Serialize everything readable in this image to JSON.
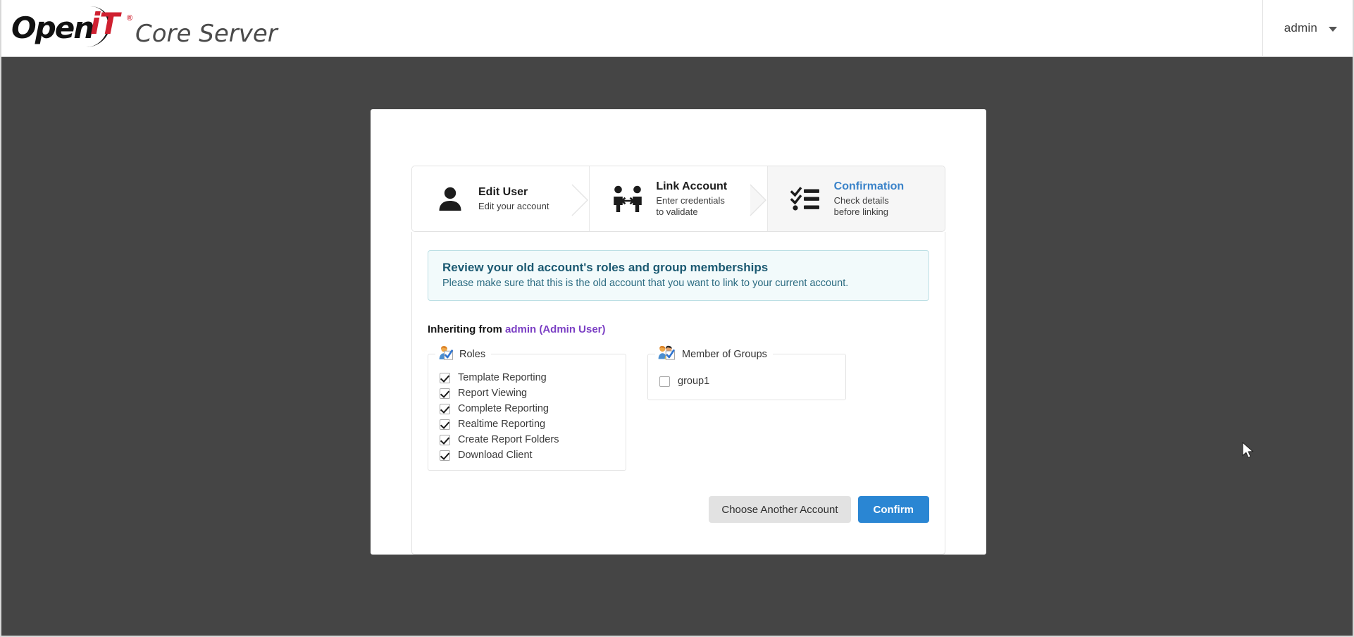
{
  "header": {
    "brand": {
      "logo_open": "Open",
      "logo_it": "iT",
      "logo_reg": "®",
      "product": "Core Server"
    },
    "user_menu": {
      "label": "admin",
      "caret_icon": "chevron-down-icon"
    }
  },
  "wizard": {
    "steps": [
      {
        "id": "edit-user",
        "icon": "user-icon",
        "title": "Edit User",
        "subtitle": "Edit your account",
        "active": false
      },
      {
        "id": "link-account",
        "icon": "link-accounts-icon",
        "title": "Link Account",
        "subtitle": "Enter credentials to validate",
        "subtitle_line1": "Enter credentials",
        "subtitle_line2": "to validate",
        "active": false
      },
      {
        "id": "confirmation",
        "icon": "checklist-icon",
        "title": "Confirmation",
        "subtitle": "Check details before linking",
        "subtitle_line1": "Check details",
        "subtitle_line2": "before linking",
        "active": true
      }
    ]
  },
  "alert": {
    "title": "Review your old account's roles and group memberships",
    "text": "Please make sure that this is the old account that you want to link to your current account."
  },
  "inheriting": {
    "prefix": "Inheriting from ",
    "account_link": "admin (Admin User)"
  },
  "roles_panel": {
    "legend": "Roles",
    "legend_icon": "user-check-icon",
    "items": [
      {
        "label": "Template Reporting",
        "checked": true
      },
      {
        "label": "Report Viewing",
        "checked": true
      },
      {
        "label": "Complete Reporting",
        "checked": true
      },
      {
        "label": "Realtime Reporting",
        "checked": true
      },
      {
        "label": "Create Report Folders",
        "checked": true
      },
      {
        "label": "Download Client",
        "checked": true
      }
    ]
  },
  "groups_panel": {
    "legend": "Member of Groups",
    "legend_icon": "group-check-icon",
    "items": [
      {
        "label": "group1",
        "checked": false
      }
    ]
  },
  "actions": {
    "secondary_label": "Choose Another Account",
    "primary_label": "Confirm"
  },
  "colors": {
    "page_background": "#454545",
    "card_background": "#ffffff",
    "primary_button": "#2a86d3",
    "active_step_text": "#3b83c9",
    "link_purple": "#7b3fc4",
    "alert_background": "#f2fafb",
    "alert_border": "#bcdfe4",
    "logo_red": "#cf2030"
  }
}
